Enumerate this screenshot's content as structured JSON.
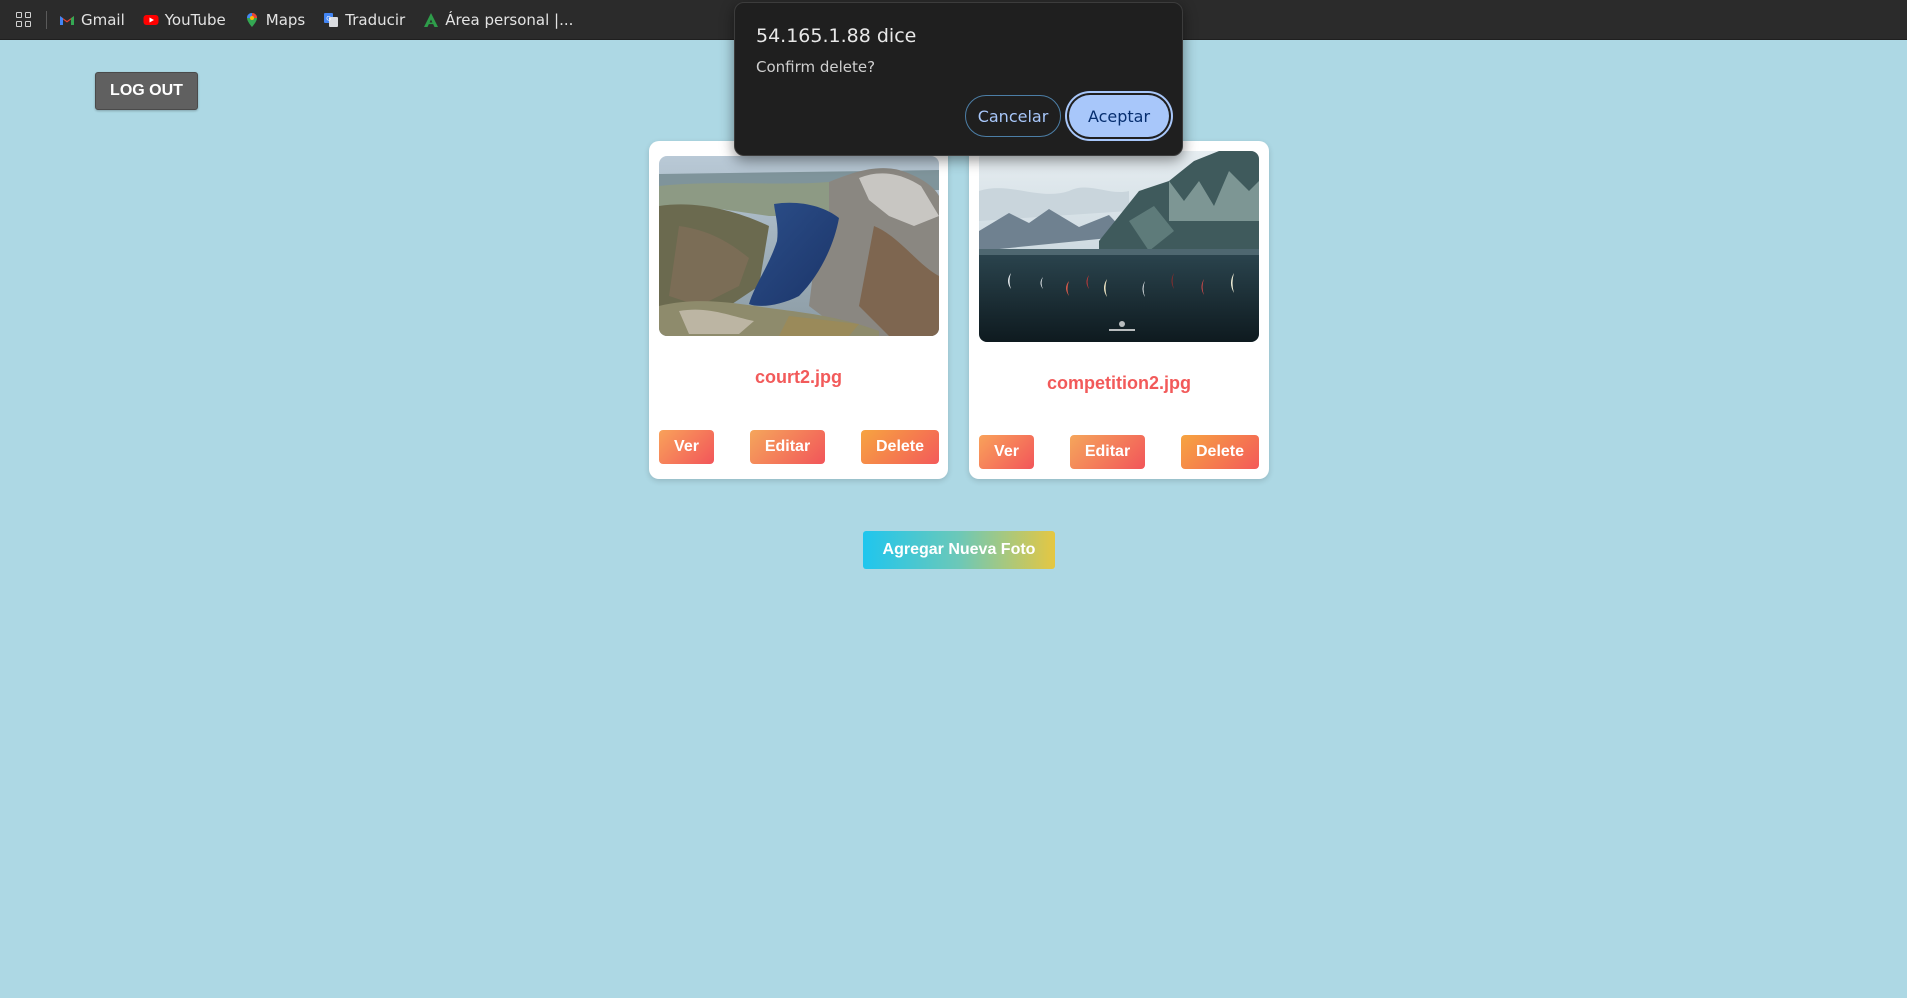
{
  "bookmarks": {
    "items": [
      {
        "label": "Gmail",
        "icon": "gmail-icon"
      },
      {
        "label": "YouTube",
        "icon": "youtube-icon"
      },
      {
        "label": "Maps",
        "icon": "maps-icon"
      },
      {
        "label": "Traducir",
        "icon": "translate-icon"
      },
      {
        "label": "Área personal |...",
        "icon": "area-personal-icon"
      }
    ]
  },
  "header": {
    "logout_label": "LOG OUT"
  },
  "gallery": {
    "cards": [
      {
        "filename": "court2.jpg",
        "view_label": "Ver",
        "edit_label": "Editar",
        "delete_label": "Delete"
      },
      {
        "filename": "competition2.jpg",
        "view_label": "Ver",
        "edit_label": "Editar",
        "delete_label": "Delete"
      }
    ],
    "add_label": "Agregar Nueva Foto"
  },
  "dialog": {
    "title": "54.165.1.88 dice",
    "message": "Confirm delete?",
    "cancel_label": "Cancelar",
    "accept_label": "Aceptar"
  },
  "colors": {
    "page_background": "#add8e4",
    "title_red": "#f25a5a",
    "dialog_accent": "#a8c7fa"
  }
}
